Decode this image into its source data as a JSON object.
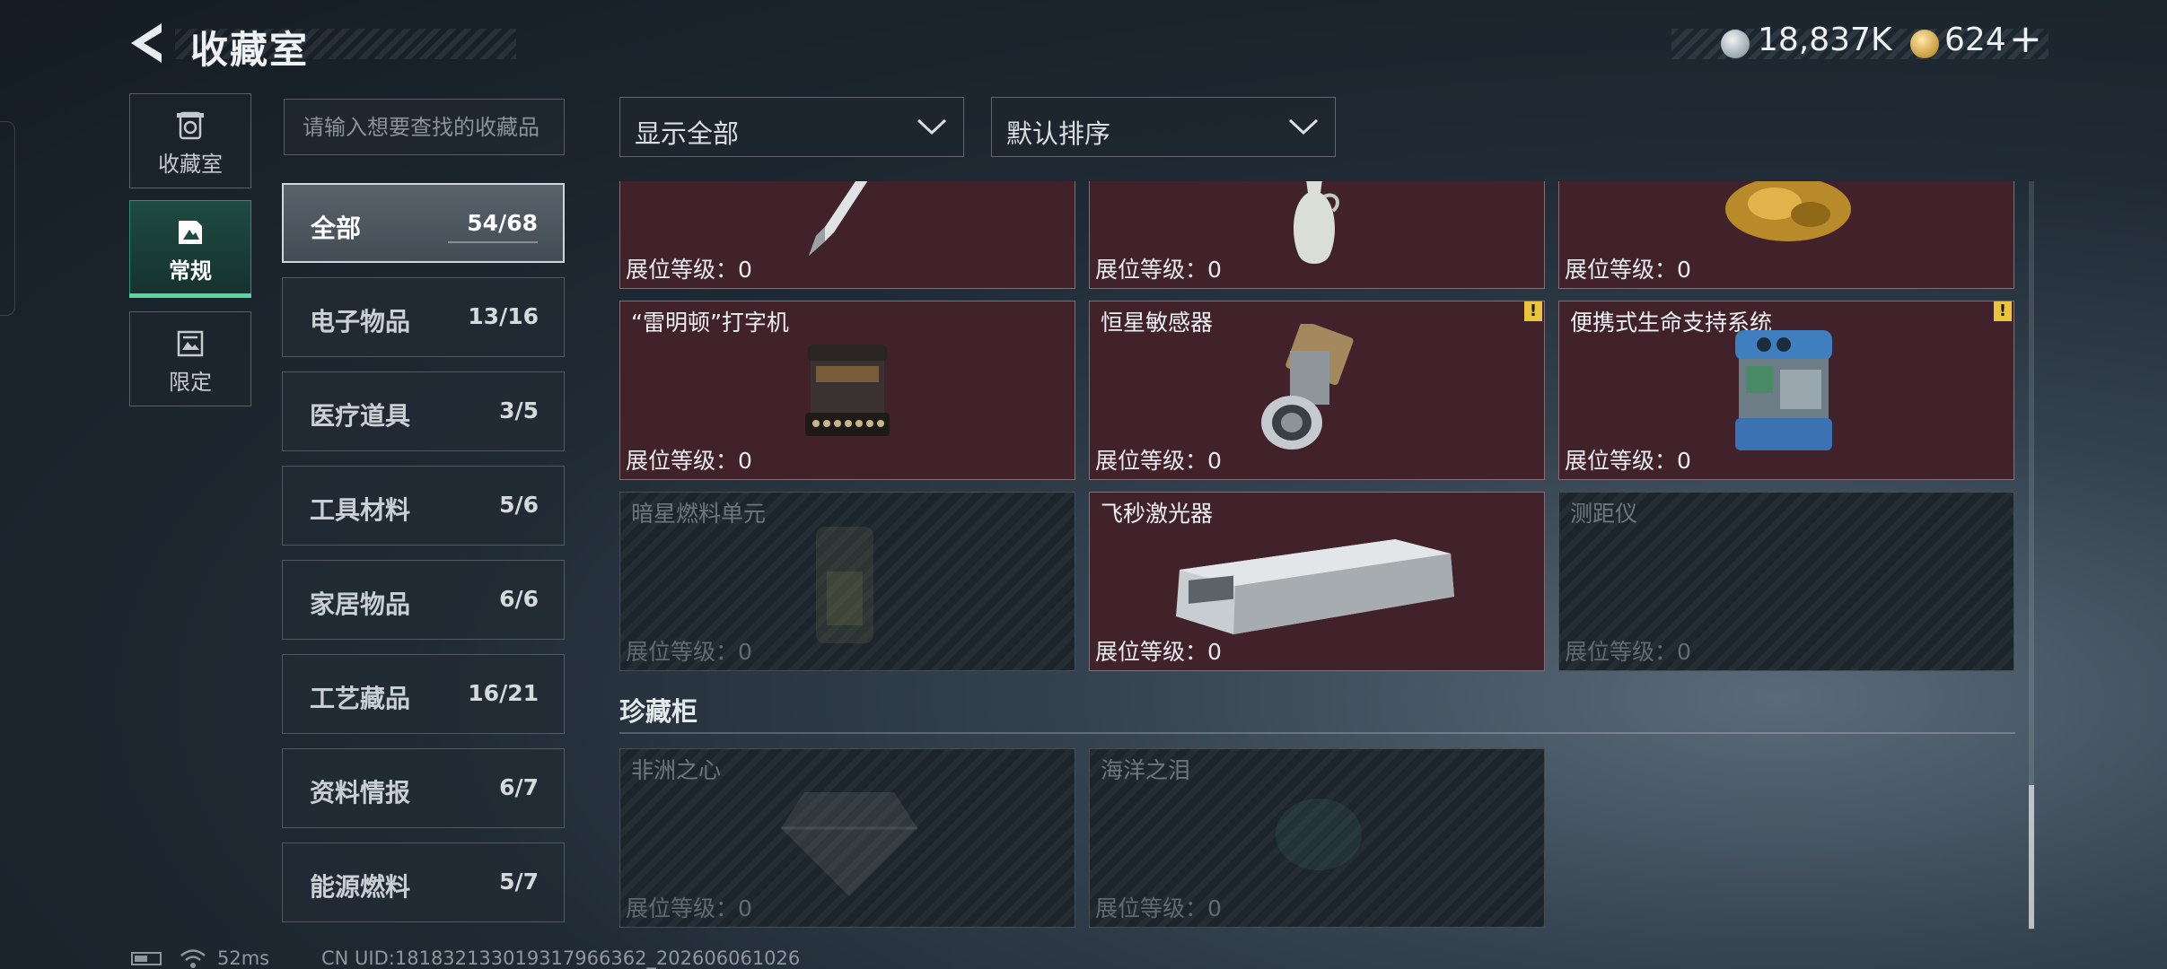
{
  "header": {
    "title": "收藏室",
    "currency_silver": "18,837K",
    "currency_gold": "624",
    "plus": "+"
  },
  "nav": [
    {
      "label": "收藏室",
      "icon": "vault-icon"
    },
    {
      "label": "常规",
      "icon": "picture-icon"
    },
    {
      "label": "限定",
      "icon": "limited-icon"
    }
  ],
  "search": {
    "placeholder": "请输入想要查找的收藏品"
  },
  "categories": [
    {
      "label": "全部",
      "count": "54/68"
    },
    {
      "label": "电子物品",
      "count": "13/16"
    },
    {
      "label": "医疗道具",
      "count": "3/5"
    },
    {
      "label": "工具材料",
      "count": "5/6"
    },
    {
      "label": "家居物品",
      "count": "6/6"
    },
    {
      "label": "工艺藏品",
      "count": "16/21"
    },
    {
      "label": "资料情报",
      "count": "6/7"
    },
    {
      "label": "能源燃料",
      "count": "5/7"
    }
  ],
  "filters": {
    "show": "显示全部",
    "sort": "默认排序"
  },
  "items": [
    {
      "name": "",
      "level": "展位等级：0",
      "collected": true
    },
    {
      "name": "",
      "level": "展位等级：0",
      "collected": true
    },
    {
      "name": "",
      "level": "展位等级：0",
      "collected": true
    },
    {
      "name": "“雷明顿”打字机",
      "level": "展位等级：0",
      "collected": true
    },
    {
      "name": "恒星敏感器",
      "level": "展位等级：0",
      "collected": true,
      "warn": "!"
    },
    {
      "name": "便携式生命支持系统",
      "level": "展位等级：0",
      "collected": true,
      "warn": "!"
    },
    {
      "name": "暗星燃料单元",
      "level": "展位等级：0",
      "collected": false
    },
    {
      "name": "飞秒激光器",
      "level": "展位等级：0",
      "collected": true
    },
    {
      "name": "测距仪",
      "level": "展位等级：0",
      "collected": false
    }
  ],
  "treasure": {
    "title": "珍藏柜",
    "items": [
      {
        "name": "非洲之心",
        "level": "展位等级：0",
        "collected": false
      },
      {
        "name": "海洋之泪",
        "level": "展位等级：0",
        "collected": false
      }
    ]
  },
  "footer": {
    "ping": "52ms",
    "uid": "CN UID:18183213301931796636​2_202606061026"
  },
  "colors": {
    "accent": "#58d6a2",
    "card_bg": "#41212a",
    "warn": "#e9c43c"
  }
}
